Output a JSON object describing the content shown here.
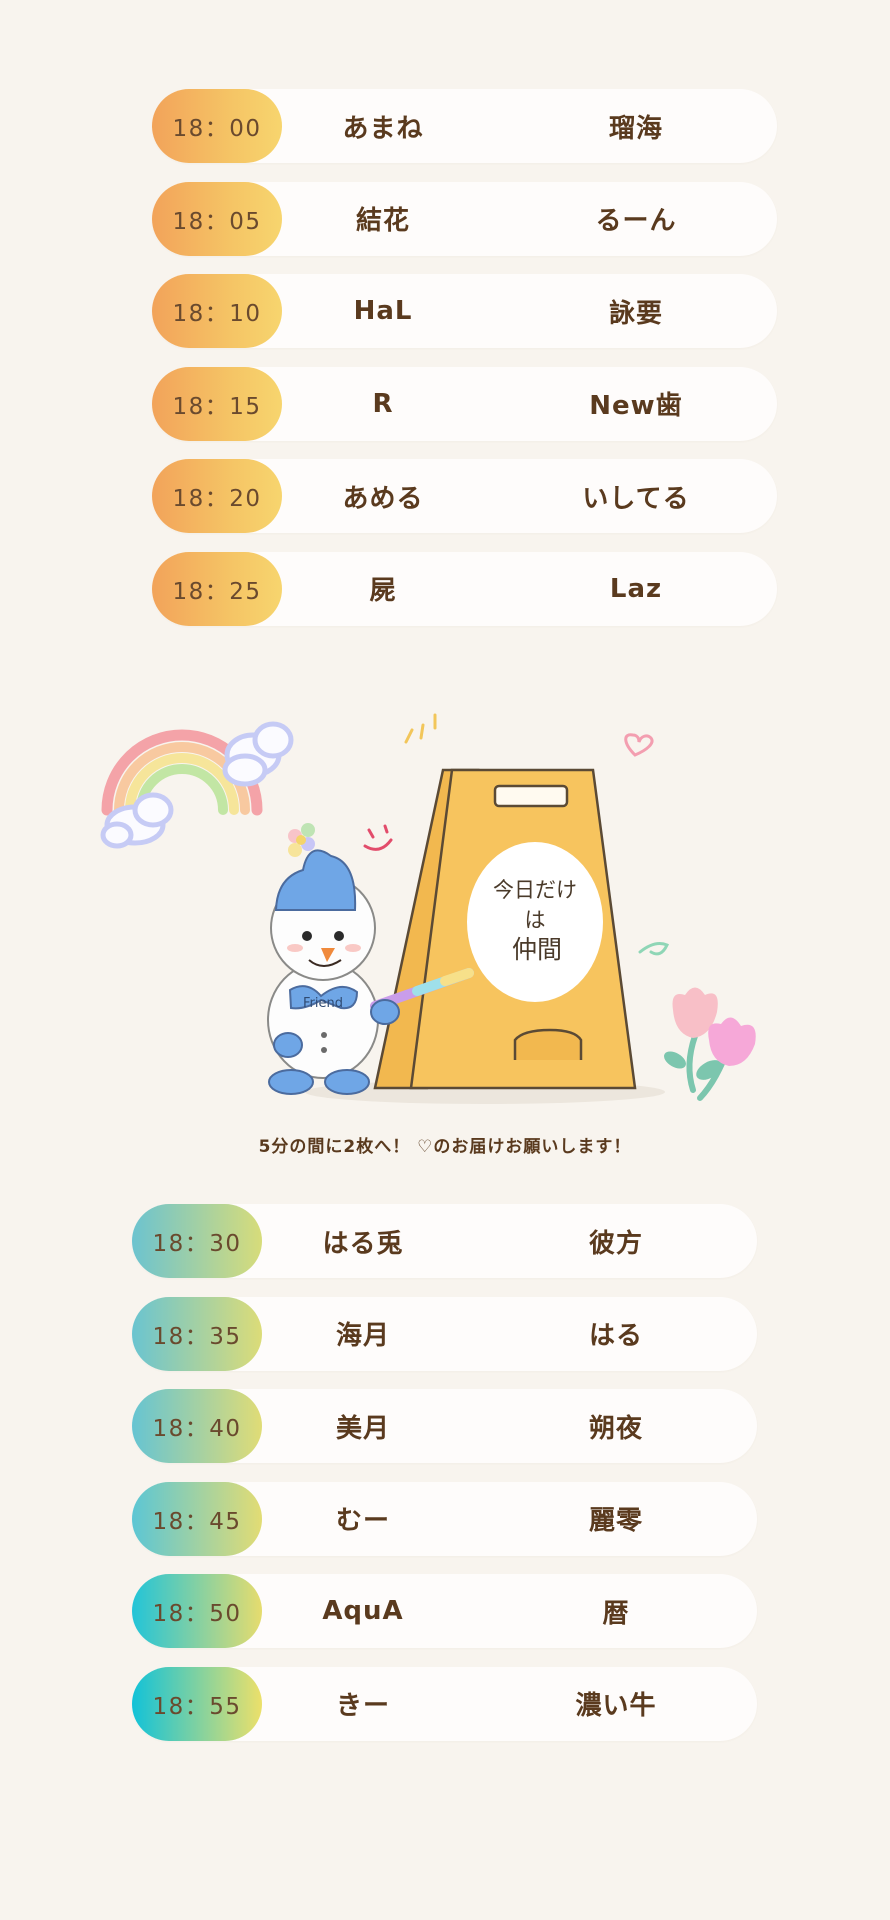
{
  "top_schedule": [
    {
      "time": "18：00",
      "performer_a": "あまね",
      "performer_b": "瑠海"
    },
    {
      "time": "18：05",
      "performer_a": "結花",
      "performer_b": "るーん"
    },
    {
      "time": "18：10",
      "performer_a": "HaL",
      "performer_b": "詠要"
    },
    {
      "time": "18：15",
      "performer_a": "R",
      "performer_b": "New歯"
    },
    {
      "time": "18：20",
      "performer_a": "あめる",
      "performer_b": "いしてる"
    },
    {
      "time": "18：25",
      "performer_a": "屍",
      "performer_b": "Laz"
    }
  ],
  "illustration": {
    "sign_text": [
      "今日だけ",
      "は",
      "仲間"
    ],
    "bow_text": "Friend",
    "icon_names": [
      "rainbow-icon",
      "snowman-icon",
      "a-frame-sign-icon",
      "tulip-icon",
      "heart-icon",
      "smile-icon"
    ]
  },
  "message": "5分の間に2枚へ！ ♡のお届けお願いします！",
  "bottom_schedule": [
    {
      "time": "18：30",
      "performer_a": "はる兎",
      "performer_b": "彼方"
    },
    {
      "time": "18：35",
      "performer_a": "海月",
      "performer_b": "はる"
    },
    {
      "time": "18：40",
      "performer_a": "美月",
      "performer_b": "朔夜"
    },
    {
      "time": "18：45",
      "performer_a": "むー",
      "performer_b": "麗零"
    },
    {
      "time": "18：50",
      "performer_a": "AquA",
      "performer_b": "暦"
    },
    {
      "time": "18：55",
      "performer_a": "きー",
      "performer_b": "濃い牛"
    }
  ],
  "colors": {
    "background": "#f8f4ee",
    "text": "#5a3a1e",
    "top_time_gradient": [
      "#f2a35a",
      "#f7d56e"
    ],
    "bottom_time_gradient": [
      "#12c2d8",
      "#ece06a"
    ],
    "sign": "#f7c45e"
  }
}
